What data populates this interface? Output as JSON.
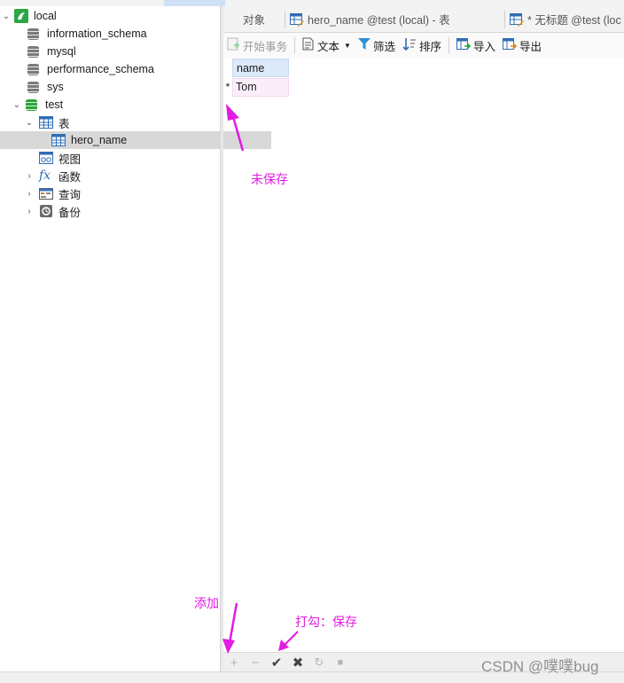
{
  "tree": {
    "connection": "local",
    "databases": [
      "information_schema",
      "mysql",
      "performance_schema",
      "sys",
      "test"
    ],
    "tables_node": "表",
    "table_item": "hero_name",
    "views_node": "视图",
    "functions_node": "函数",
    "queries_node": "查询",
    "backups_node": "备份"
  },
  "tabs": [
    "对象",
    "hero_name @test (local) - 表",
    "* 无标题 @test (loc"
  ],
  "toolbar": {
    "begin_transaction": "开始事务",
    "text": "文本",
    "filter": "筛选",
    "sort": "排序",
    "import": "导入",
    "export": "导出"
  },
  "grid": {
    "column": "name",
    "row_marker": "*",
    "value": "Tom"
  },
  "bottom_buttons": [
    "add",
    "delete",
    "apply",
    "discard",
    "refresh",
    "stop"
  ],
  "annotations": {
    "unsaved": "未保存",
    "add": "添加",
    "check_save": "打勾：保存"
  },
  "watermark": "CSDN @噗噗bug",
  "colors": {
    "annotation": "#e21be2",
    "selected_row": "#d8d8d8",
    "header": "#dbe9f8"
  }
}
